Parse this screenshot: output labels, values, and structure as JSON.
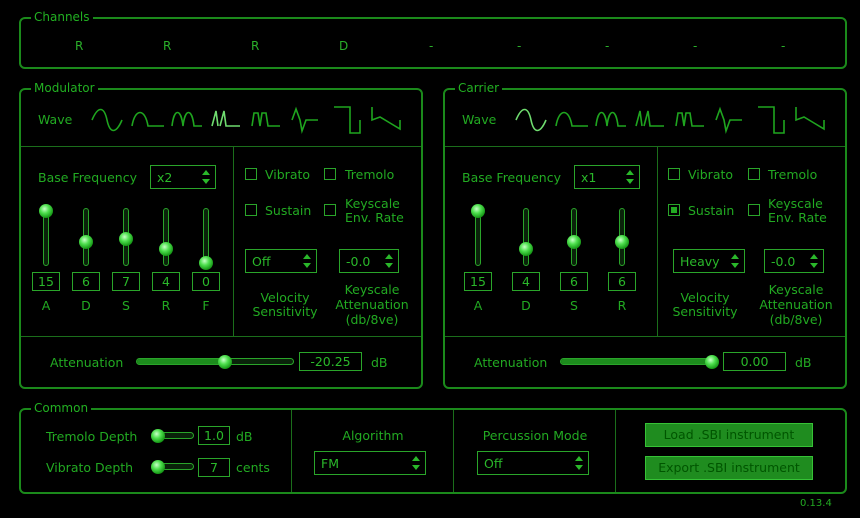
{
  "channels": {
    "title": "Channels",
    "items": [
      "R",
      "R",
      "R",
      "D",
      "-",
      "-",
      "-",
      "-",
      "-"
    ]
  },
  "modulator": {
    "title": "Modulator",
    "wave_label": "Wave",
    "base_freq_label": "Base Frequency",
    "base_freq_value": "x2",
    "vibrato_label": "Vibrato",
    "tremolo_label": "Tremolo",
    "sustain_label": "Sustain",
    "keyscale_env_label_1": "Keyscale",
    "keyscale_env_label_2": "Env. Rate",
    "vibrato_checked": false,
    "tremolo_checked": false,
    "sustain_checked": false,
    "keyscale_env_checked": false,
    "velocity_value": "Off",
    "velocity_label_1": "Velocity",
    "velocity_label_2": "Sensitivity",
    "keyscale_att_value": "-0.0",
    "keyscale_att_label_1": "Keyscale",
    "keyscale_att_label_2": "Attenuation",
    "keyscale_att_label_3": "(db/8ve)",
    "sliders": [
      {
        "label": "A",
        "value": "15",
        "level": 1.0
      },
      {
        "label": "D",
        "value": "6",
        "level": 0.4
      },
      {
        "label": "S",
        "value": "7",
        "level": 0.47
      },
      {
        "label": "R",
        "value": "4",
        "level": 0.27
      },
      {
        "label": "F",
        "value": "0",
        "level": 0.0
      }
    ],
    "attenuation_label": "Attenuation",
    "attenuation_value": "-20.25",
    "attenuation_unit": "dB",
    "attenuation_level": 0.57
  },
  "carrier": {
    "title": "Carrier",
    "wave_label": "Wave",
    "base_freq_label": "Base Frequency",
    "base_freq_value": "x1",
    "vibrato_label": "Vibrato",
    "tremolo_label": "Tremolo",
    "sustain_label": "Sustain",
    "keyscale_env_label_1": "Keyscale",
    "keyscale_env_label_2": "Env. Rate",
    "vibrato_checked": false,
    "tremolo_checked": false,
    "sustain_checked": true,
    "keyscale_env_checked": false,
    "velocity_value": "Heavy",
    "velocity_label_1": "Velocity",
    "velocity_label_2": "Sensitivity",
    "keyscale_att_value": "-0.0",
    "keyscale_att_label_1": "Keyscale",
    "keyscale_att_label_2": "Attenuation",
    "keyscale_att_label_3": "(db/8ve)",
    "sliders": [
      {
        "label": "A",
        "value": "15",
        "level": 1.0
      },
      {
        "label": "D",
        "value": "4",
        "level": 0.27
      },
      {
        "label": "S",
        "value": "6",
        "level": 0.4
      },
      {
        "label": "R",
        "value": "6",
        "level": 0.4
      }
    ],
    "attenuation_label": "Attenuation",
    "attenuation_value": "0.00",
    "attenuation_unit": "dB",
    "attenuation_level": 1.0
  },
  "common": {
    "title": "Common",
    "tremolo_depth_label": "Tremolo Depth",
    "tremolo_depth_value": "1.0",
    "tremolo_depth_unit": "dB",
    "vibrato_depth_label": "Vibrato Depth",
    "vibrato_depth_value": "7",
    "vibrato_depth_unit": "cents",
    "algorithm_label": "Algorithm",
    "algorithm_value": "FM",
    "percussion_label": "Percussion Mode",
    "percussion_value": "Off",
    "load_button": "Load .SBI instrument",
    "export_button": "Export .SBI instrument"
  },
  "version": "0.13.4",
  "colors": {
    "accent": "#1fa51f",
    "background": "#000000",
    "button": "#1f8c1f"
  }
}
